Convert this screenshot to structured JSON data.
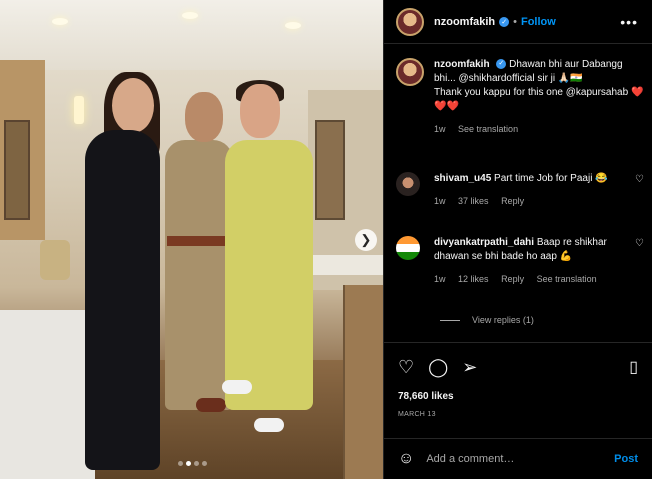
{
  "post": {
    "username": "nzoomfakih",
    "follow_label": "Follow",
    "more_icon": "more-horizontal-icon",
    "caption_line1": "Dhawan bhi aur Dabangg bhi... @shikhardofficial sir ji 🙏🏻🇮🇳",
    "caption_line2": "Thank you kappu for this one @kapursahab ❤️❤️❤️",
    "caption_age": "1w",
    "caption_translation": "See translation"
  },
  "comments": [
    {
      "username": "shivam_u45",
      "text": "Part time Job for Paaji 😂",
      "age": "1w",
      "likes": "37 likes",
      "reply": "Reply"
    },
    {
      "username": "divyankatrpathi_dahi",
      "text": "Baap re shikhar dhawan se bhi bade ho aap 💪",
      "age": "1w",
      "likes": "12 likes",
      "reply": "Reply",
      "translation": "See translation"
    }
  ],
  "view_replies": "View replies (1)",
  "stats": {
    "likes": "78,660 likes",
    "date": "MARCH 13"
  },
  "add_comment": {
    "placeholder": "Add a comment…",
    "post_label": "Post"
  },
  "carousel": {
    "total": 4,
    "active_index": 1
  },
  "colors": {
    "accent": "#0095f6",
    "verified": "#3897f0",
    "like_red": "#ed4956"
  }
}
